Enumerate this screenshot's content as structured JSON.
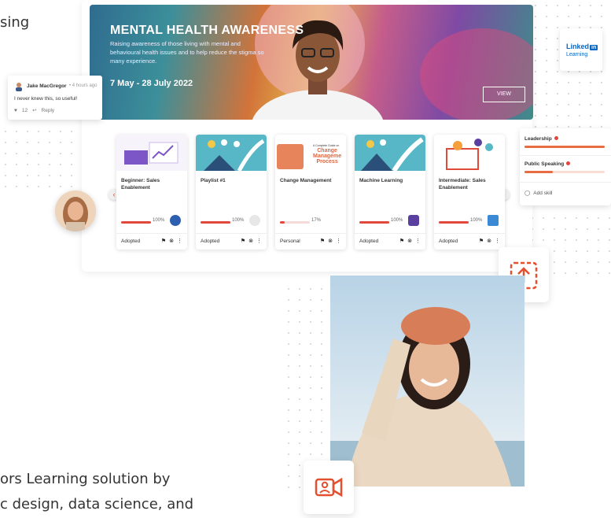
{
  "cut_text": {
    "top_line": "sing",
    "bottom_line1": "ors Learning solution by",
    "bottom_line2": "c design, data science, and"
  },
  "hero": {
    "title": "MENTAL HEALTH AWARENESS",
    "description": "Raising awareness of those living with mental and behavioural health issues and to help reduce the stigma so many experience.",
    "dates": "7 May - 28 July 2022",
    "view_label": "VIEW"
  },
  "comment": {
    "author": "Jake MacGregor",
    "time": "• 4 hours ago",
    "text": "I never knew this, so useful!",
    "likes": "12",
    "reply_label": "Reply"
  },
  "linkedin": {
    "word": "Linked",
    "badge": "in",
    "sub": "Learning"
  },
  "courses": [
    {
      "name": "Beginner: Sales Enablement",
      "progress": "100%",
      "status": "Adopted",
      "badge_color": "#2c5fb0",
      "progress_value": 100
    },
    {
      "name": "Playlist #1",
      "progress": "100%",
      "status": "Adopted",
      "badge_color": "#b8b8b8",
      "progress_value": 100
    },
    {
      "name": "Change Management",
      "progress": "17%",
      "status": "Personal",
      "badge_color": "",
      "progress_value": 17
    },
    {
      "name": "Machine Learning",
      "progress": "100%",
      "status": "Adopted",
      "badge_color": "#5a3fa0",
      "progress_value": 100
    },
    {
      "name": "Intermediate: Sales Enablement",
      "progress": "100%",
      "status": "Adopted",
      "badge_color": "#3a8ad6",
      "progress_value": 100
    }
  ],
  "course3_thumb": {
    "small": "A Complete Guide on",
    "big1": "Change",
    "big2": "Manageme",
    "big3": "Process"
  },
  "skills": {
    "items": [
      {
        "label": "Leadership",
        "level": 1.0
      },
      {
        "label": "Public Speaking",
        "level": 0.35
      }
    ],
    "add_label": "Add skill"
  },
  "colors": {
    "accent": "#e0483b",
    "linkedin": "#0a66c2"
  }
}
